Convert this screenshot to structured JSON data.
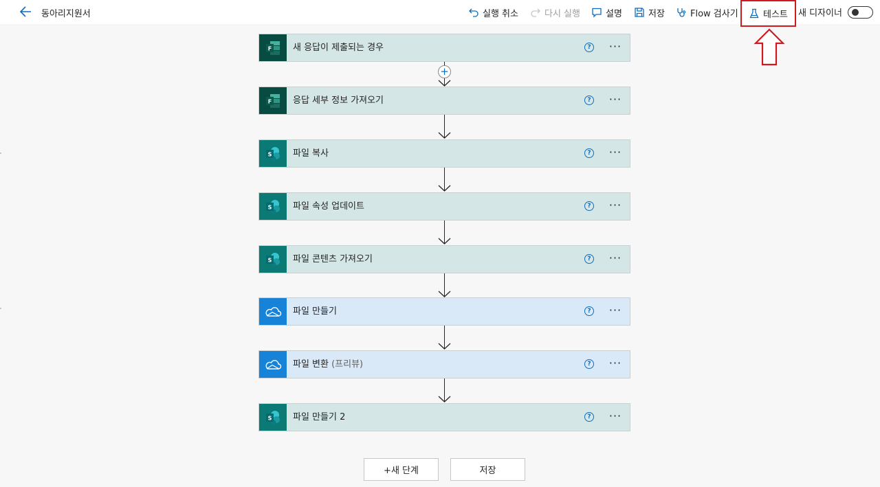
{
  "header": {
    "title": "동아리지원서",
    "undo_label": "실행 취소",
    "redo_label": "다시 실행",
    "comments_label": "설명",
    "save_label": "저장",
    "checker_label": "Flow 검사기",
    "test_label": "테스트",
    "new_designer_label": "새 디자이너"
  },
  "steps": [
    {
      "label": "새 응답이 제출되는 경우",
      "suffix": "",
      "connector": "forms",
      "help": "?",
      "more": "···"
    },
    {
      "label": "응답 세부 정보 가져오기",
      "suffix": "",
      "connector": "forms",
      "help": "?",
      "more": "···"
    },
    {
      "label": "파일 복사",
      "suffix": "",
      "connector": "sharepoint",
      "help": "?",
      "more": "···"
    },
    {
      "label": "파일 속성 업데이트",
      "suffix": "",
      "connector": "sharepoint",
      "help": "?",
      "more": "···"
    },
    {
      "label": "파일 콘텐츠 가져오기",
      "suffix": "",
      "connector": "sharepoint",
      "help": "?",
      "more": "···"
    },
    {
      "label": "파일 만들기",
      "suffix": "",
      "connector": "onedrive",
      "help": "?",
      "more": "···"
    },
    {
      "label": "파일 변환 ",
      "suffix": "(프리뷰)",
      "connector": "onedrive",
      "help": "?",
      "more": "···"
    },
    {
      "label": "파일 만들기 2",
      "suffix": "",
      "connector": "sharepoint",
      "help": "?",
      "more": "···"
    }
  ],
  "insert_step_symbol": "+",
  "footer": {
    "new_step_label": "+새 단계",
    "save_label": "저장"
  },
  "colors": {
    "forms_icon_bg": "#084c41",
    "sharepoint_icon_bg": "#0b7a75",
    "onedrive_icon_bg": "#1683d8",
    "teal_card_bg": "#d4e6e5",
    "blue_card_bg": "#d9e9f7",
    "accent": "#0f6cbd",
    "highlight_box": "#d0191e"
  },
  "icons": {
    "forms": "microsoft-forms-icon",
    "sharepoint": "sharepoint-icon",
    "onedrive": "onedrive-icon"
  }
}
